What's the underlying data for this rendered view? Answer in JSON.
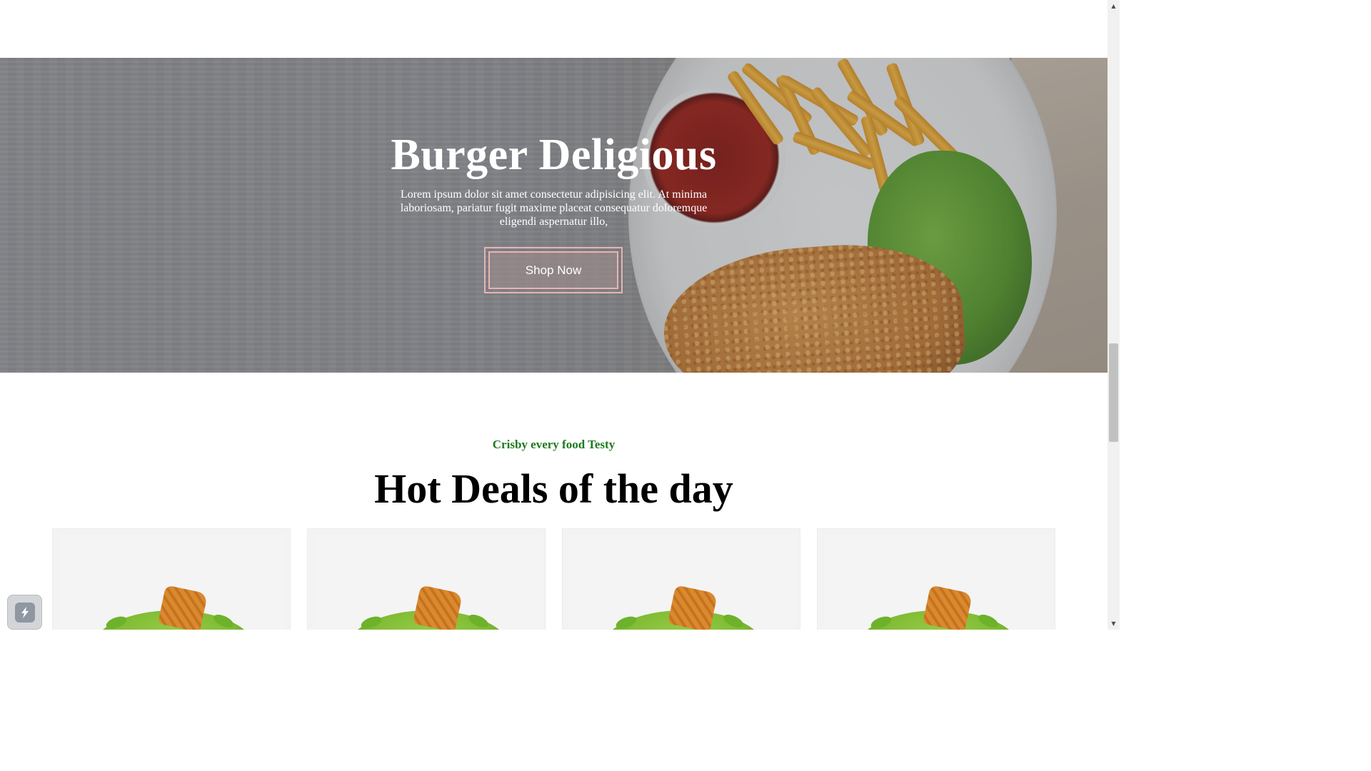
{
  "hero": {
    "title": "Burger Deligious",
    "text": "Lorem ipsum dolor sit amet consectetur adipisicing elit. At minima laboriosam, pariatur fugit maxime placeat consequatur doloremque eligendi aspernatur illo,",
    "button_label": "Shop Now"
  },
  "deals": {
    "subtitle": "Crisby every food Testy",
    "title": "Hot Deals of the day",
    "cards": [
      {
        "image_icon": "salad-image"
      },
      {
        "image_icon": "salad-image"
      },
      {
        "image_icon": "salad-image"
      },
      {
        "image_icon": "salad-image"
      }
    ]
  },
  "widget": {
    "icon": "lightning-icon"
  },
  "colors": {
    "accent_green": "#1d7a1d",
    "button_border": "#e8b3b3"
  }
}
